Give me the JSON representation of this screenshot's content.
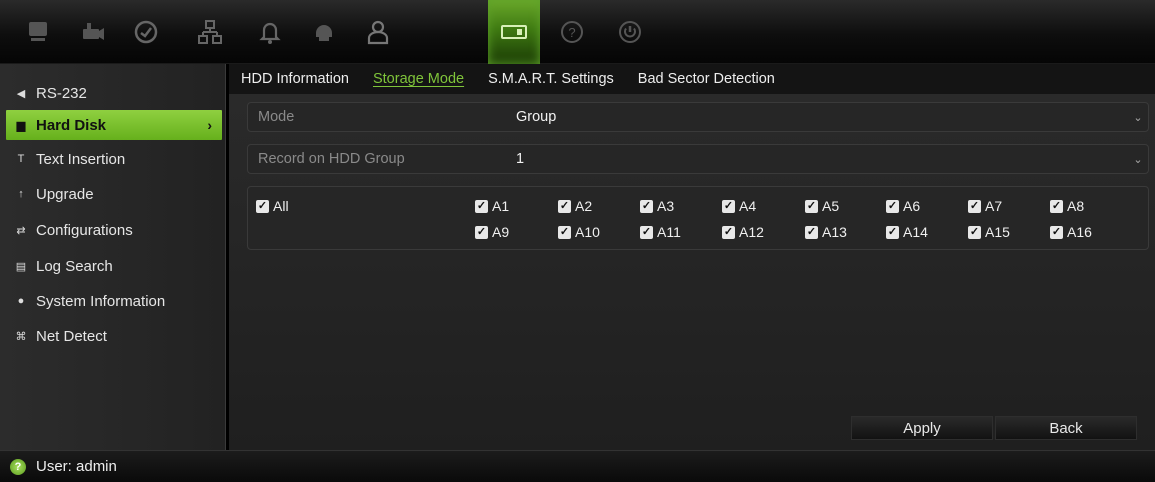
{
  "toolbar": {
    "icons": [
      "monitor-icon",
      "camera-icon",
      "gauge-icon",
      "network-icon",
      "bell-icon",
      "dome-camera-icon",
      "user-icon",
      "device-management-icon",
      "help-icon",
      "power-icon"
    ],
    "active_index": 7
  },
  "sidebar": {
    "items": [
      {
        "label": "RS-232",
        "icon": "rs232-icon"
      },
      {
        "label": "Hard Disk",
        "icon": "hard-disk-icon",
        "active": true
      },
      {
        "label": "Text Insertion",
        "icon": "text-insertion-icon"
      },
      {
        "label": "Upgrade",
        "icon": "upgrade-icon"
      },
      {
        "label": "Configurations",
        "icon": "configurations-icon"
      },
      {
        "label": "Log Search",
        "icon": "log-search-icon"
      },
      {
        "label": "System Information",
        "icon": "system-information-icon"
      },
      {
        "label": "Net Detect",
        "icon": "net-detect-icon"
      }
    ],
    "chevron": "›"
  },
  "tabs": [
    {
      "label": "HDD Information"
    },
    {
      "label": "Storage Mode",
      "active": true
    },
    {
      "label": "S.M.A.R.T. Settings"
    },
    {
      "label": "Bad Sector Detection"
    }
  ],
  "form": {
    "mode_label": "Mode",
    "mode_value": "Group",
    "group_label": "Record on HDD Group",
    "group_value": "1",
    "dropdown_glyph": "⌄"
  },
  "checkboxes": {
    "all_label": "All",
    "cameras": [
      "A1",
      "A2",
      "A3",
      "A4",
      "A5",
      "A6",
      "A7",
      "A8",
      "A9",
      "A10",
      "A11",
      "A12",
      "A13",
      "A14",
      "A15",
      "A16"
    ],
    "checked": true
  },
  "buttons": {
    "apply": "Apply",
    "back": "Back"
  },
  "status": {
    "user": "User: admin",
    "icon": "?"
  },
  "colors": {
    "accent": "#7fc43a",
    "active_item": "#7cc22e"
  }
}
